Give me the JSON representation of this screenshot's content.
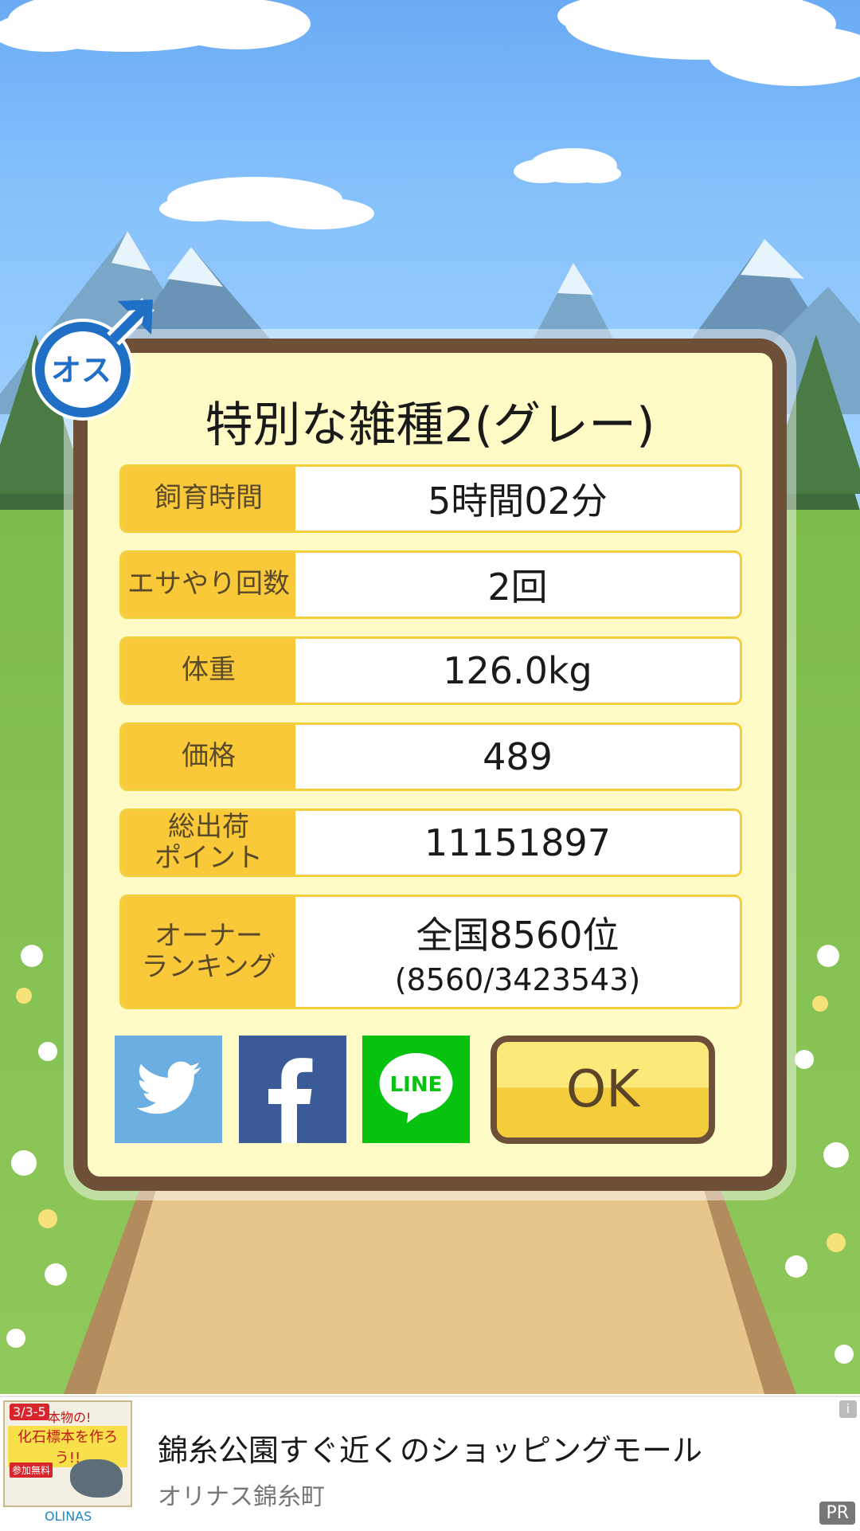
{
  "dialog": {
    "title": "特別な雑種2(グレー)",
    "stats": [
      {
        "label": "飼育時間",
        "value": "5時間02分"
      },
      {
        "label": "エサやり回数",
        "value": "2回"
      },
      {
        "label": "体重",
        "value": "126.0kg"
      },
      {
        "label": "価格",
        "value": "489"
      },
      {
        "label": "総出荷\nポイント",
        "value": "11151897"
      },
      {
        "label": "オーナー\nランキング",
        "value": "全国8560位",
        "sub": "(8560/3423543)"
      }
    ],
    "badge_text": "オス",
    "ok_label": "OK",
    "share": {
      "line_label": "LINE"
    }
  },
  "ad": {
    "title": "錦糸公園すぐ近くのショッピングモール",
    "subtitle": "オリナス錦糸町",
    "thumb_dates": "3/3-5",
    "thumb_tag": "本物の!",
    "thumb_headline": "化石標本を作ろう!!",
    "thumb_badge": "参加無料",
    "brand": "OLINAS",
    "info_icon": "i",
    "pr_label": "PR"
  },
  "colors": {
    "frame": "#6e4f37",
    "panel": "#fffbc6",
    "label_bg": "#f9c93a",
    "twitter": "#6aaee2",
    "facebook": "#3b5b98",
    "line": "#08c210"
  }
}
